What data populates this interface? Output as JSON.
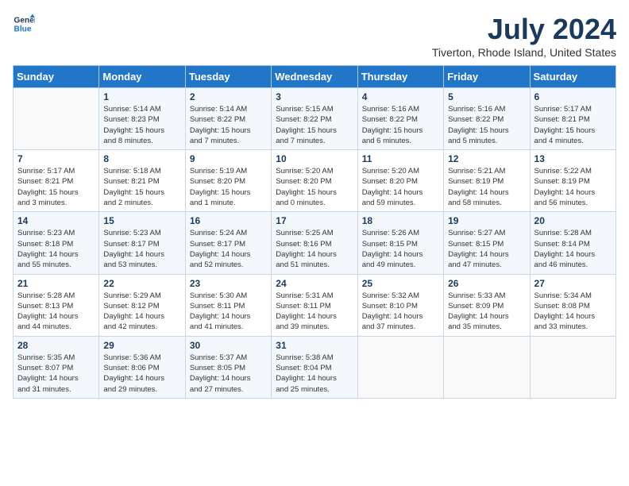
{
  "logo": {
    "line1": "General",
    "line2": "Blue"
  },
  "title": "July 2024",
  "location": "Tiverton, Rhode Island, United States",
  "weekdays": [
    "Sunday",
    "Monday",
    "Tuesday",
    "Wednesday",
    "Thursday",
    "Friday",
    "Saturday"
  ],
  "weeks": [
    [
      {
        "day": "",
        "info": ""
      },
      {
        "day": "1",
        "info": "Sunrise: 5:14 AM\nSunset: 8:23 PM\nDaylight: 15 hours\nand 8 minutes."
      },
      {
        "day": "2",
        "info": "Sunrise: 5:14 AM\nSunset: 8:22 PM\nDaylight: 15 hours\nand 7 minutes."
      },
      {
        "day": "3",
        "info": "Sunrise: 5:15 AM\nSunset: 8:22 PM\nDaylight: 15 hours\nand 7 minutes."
      },
      {
        "day": "4",
        "info": "Sunrise: 5:16 AM\nSunset: 8:22 PM\nDaylight: 15 hours\nand 6 minutes."
      },
      {
        "day": "5",
        "info": "Sunrise: 5:16 AM\nSunset: 8:22 PM\nDaylight: 15 hours\nand 5 minutes."
      },
      {
        "day": "6",
        "info": "Sunrise: 5:17 AM\nSunset: 8:21 PM\nDaylight: 15 hours\nand 4 minutes."
      }
    ],
    [
      {
        "day": "7",
        "info": "Sunrise: 5:17 AM\nSunset: 8:21 PM\nDaylight: 15 hours\nand 3 minutes."
      },
      {
        "day": "8",
        "info": "Sunrise: 5:18 AM\nSunset: 8:21 PM\nDaylight: 15 hours\nand 2 minutes."
      },
      {
        "day": "9",
        "info": "Sunrise: 5:19 AM\nSunset: 8:20 PM\nDaylight: 15 hours\nand 1 minute."
      },
      {
        "day": "10",
        "info": "Sunrise: 5:20 AM\nSunset: 8:20 PM\nDaylight: 15 hours\nand 0 minutes."
      },
      {
        "day": "11",
        "info": "Sunrise: 5:20 AM\nSunset: 8:20 PM\nDaylight: 14 hours\nand 59 minutes."
      },
      {
        "day": "12",
        "info": "Sunrise: 5:21 AM\nSunset: 8:19 PM\nDaylight: 14 hours\nand 58 minutes."
      },
      {
        "day": "13",
        "info": "Sunrise: 5:22 AM\nSunset: 8:19 PM\nDaylight: 14 hours\nand 56 minutes."
      }
    ],
    [
      {
        "day": "14",
        "info": "Sunrise: 5:23 AM\nSunset: 8:18 PM\nDaylight: 14 hours\nand 55 minutes."
      },
      {
        "day": "15",
        "info": "Sunrise: 5:23 AM\nSunset: 8:17 PM\nDaylight: 14 hours\nand 53 minutes."
      },
      {
        "day": "16",
        "info": "Sunrise: 5:24 AM\nSunset: 8:17 PM\nDaylight: 14 hours\nand 52 minutes."
      },
      {
        "day": "17",
        "info": "Sunrise: 5:25 AM\nSunset: 8:16 PM\nDaylight: 14 hours\nand 51 minutes."
      },
      {
        "day": "18",
        "info": "Sunrise: 5:26 AM\nSunset: 8:15 PM\nDaylight: 14 hours\nand 49 minutes."
      },
      {
        "day": "19",
        "info": "Sunrise: 5:27 AM\nSunset: 8:15 PM\nDaylight: 14 hours\nand 47 minutes."
      },
      {
        "day": "20",
        "info": "Sunrise: 5:28 AM\nSunset: 8:14 PM\nDaylight: 14 hours\nand 46 minutes."
      }
    ],
    [
      {
        "day": "21",
        "info": "Sunrise: 5:28 AM\nSunset: 8:13 PM\nDaylight: 14 hours\nand 44 minutes."
      },
      {
        "day": "22",
        "info": "Sunrise: 5:29 AM\nSunset: 8:12 PM\nDaylight: 14 hours\nand 42 minutes."
      },
      {
        "day": "23",
        "info": "Sunrise: 5:30 AM\nSunset: 8:11 PM\nDaylight: 14 hours\nand 41 minutes."
      },
      {
        "day": "24",
        "info": "Sunrise: 5:31 AM\nSunset: 8:11 PM\nDaylight: 14 hours\nand 39 minutes."
      },
      {
        "day": "25",
        "info": "Sunrise: 5:32 AM\nSunset: 8:10 PM\nDaylight: 14 hours\nand 37 minutes."
      },
      {
        "day": "26",
        "info": "Sunrise: 5:33 AM\nSunset: 8:09 PM\nDaylight: 14 hours\nand 35 minutes."
      },
      {
        "day": "27",
        "info": "Sunrise: 5:34 AM\nSunset: 8:08 PM\nDaylight: 14 hours\nand 33 minutes."
      }
    ],
    [
      {
        "day": "28",
        "info": "Sunrise: 5:35 AM\nSunset: 8:07 PM\nDaylight: 14 hours\nand 31 minutes."
      },
      {
        "day": "29",
        "info": "Sunrise: 5:36 AM\nSunset: 8:06 PM\nDaylight: 14 hours\nand 29 minutes."
      },
      {
        "day": "30",
        "info": "Sunrise: 5:37 AM\nSunset: 8:05 PM\nDaylight: 14 hours\nand 27 minutes."
      },
      {
        "day": "31",
        "info": "Sunrise: 5:38 AM\nSunset: 8:04 PM\nDaylight: 14 hours\nand 25 minutes."
      },
      {
        "day": "",
        "info": ""
      },
      {
        "day": "",
        "info": ""
      },
      {
        "day": "",
        "info": ""
      }
    ]
  ]
}
